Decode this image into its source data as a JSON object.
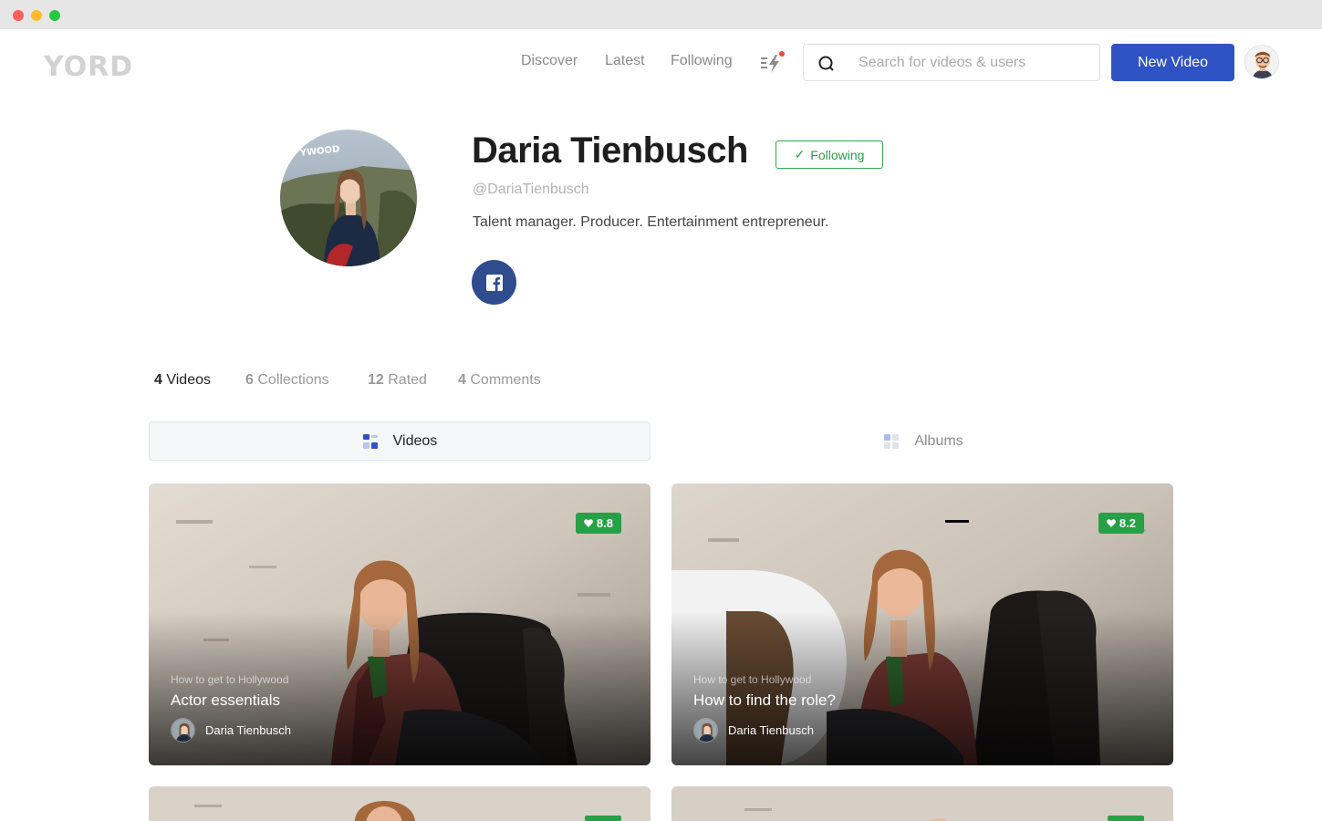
{
  "app": {
    "logo_text": "YORD"
  },
  "nav": {
    "discover": "Discover",
    "latest": "Latest",
    "following": "Following"
  },
  "search": {
    "placeholder": "Search for videos & users",
    "value": ""
  },
  "header": {
    "new_video_label": "New Video"
  },
  "profile": {
    "name": "Daria Tienbusch",
    "follow_check": "✓",
    "follow_label": "Following",
    "handle": "@DariaTienbusch",
    "bio": "Talent manager. Producer. Entertainment entrepreneur.",
    "photo_sign_text": "YWOOD"
  },
  "stats": [
    {
      "count": "4",
      "label": "Videos",
      "active": true
    },
    {
      "count": "6",
      "label": "Collections",
      "active": false
    },
    {
      "count": "12",
      "label": "Rated",
      "active": false
    },
    {
      "count": "4",
      "label": "Comments",
      "active": false
    }
  ],
  "toggle": {
    "videos_label": "Videos",
    "albums_label": "Albums"
  },
  "videos": [
    {
      "rating": "8.8",
      "series": "How to get to Hollywood",
      "title": "Actor essentials",
      "author": "Daria Tienbusch"
    },
    {
      "rating": "8.2",
      "series": "How to get to Hollywood",
      "title": "How to find the role?",
      "author": "Daria Tienbusch"
    }
  ],
  "colors": {
    "primary": "#2f52c4",
    "success": "#27a046",
    "facebook": "#2f4c8f"
  }
}
